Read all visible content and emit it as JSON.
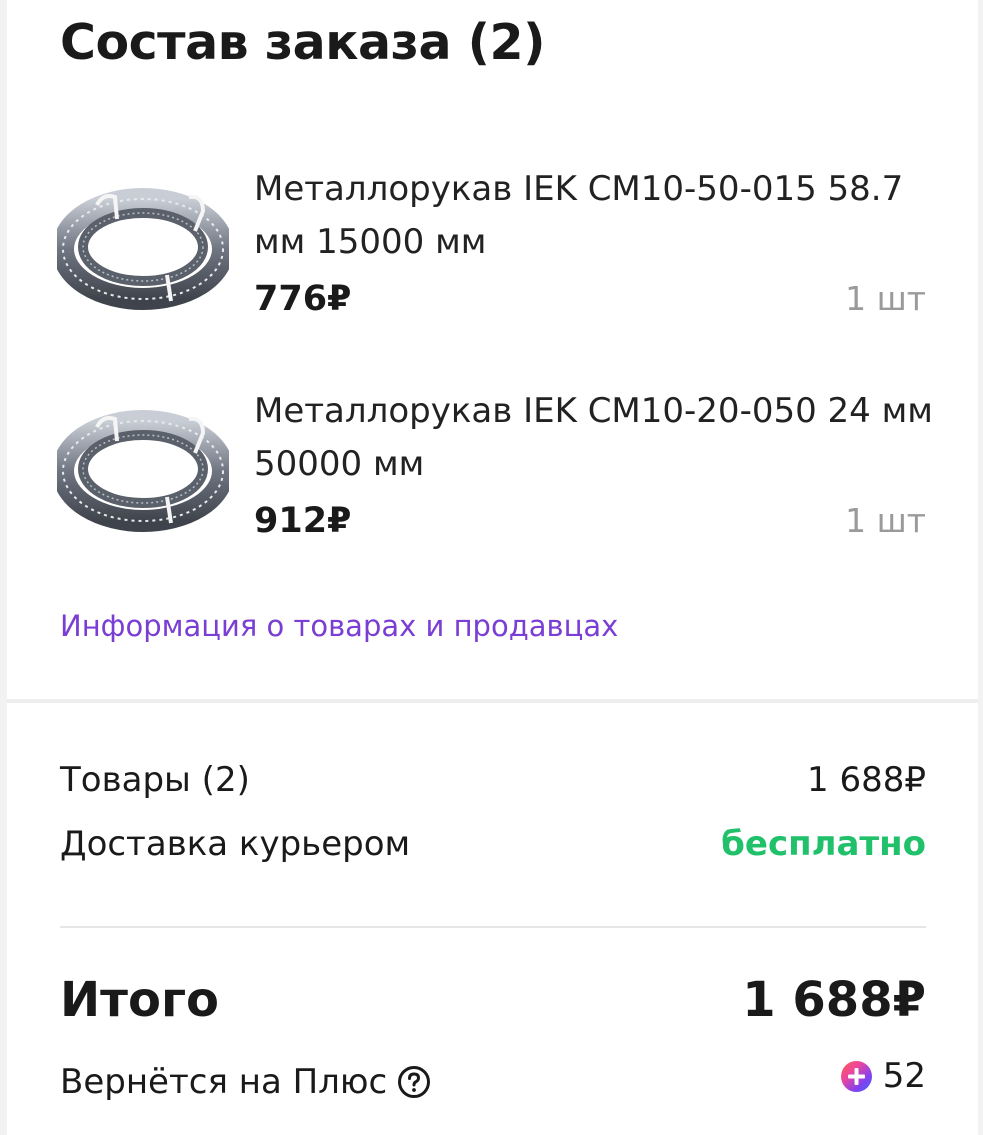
{
  "order": {
    "title": "Состав заказа (2)",
    "items": [
      {
        "name": "Металлорукав IEK CM10-50-015 58.7 мм 15000 мм",
        "price": "776₽",
        "quantity": "1 шт",
        "image_icon": "metal-hose-coil"
      },
      {
        "name": "Металлорукав IEK CM10-20-050 24 мм 50000 мм",
        "price": "912₽",
        "quantity": "1 шт",
        "image_icon": "metal-hose-coil"
      }
    ],
    "info_link": "Информация о товарах и продавцах"
  },
  "summary": {
    "goods_label": "Товары (2)",
    "goods_value": "1 688₽",
    "delivery_label": "Доставка курьером",
    "delivery_value": "бесплатно",
    "total_label": "Итого",
    "total_value": "1 688₽",
    "plus_label": "Вернётся на Плюс",
    "plus_value": "52"
  },
  "colors": {
    "link": "#7a3ed4",
    "free_delivery": "#21c06b",
    "muted": "#9a9a9a",
    "text": "#1a1a1a"
  }
}
